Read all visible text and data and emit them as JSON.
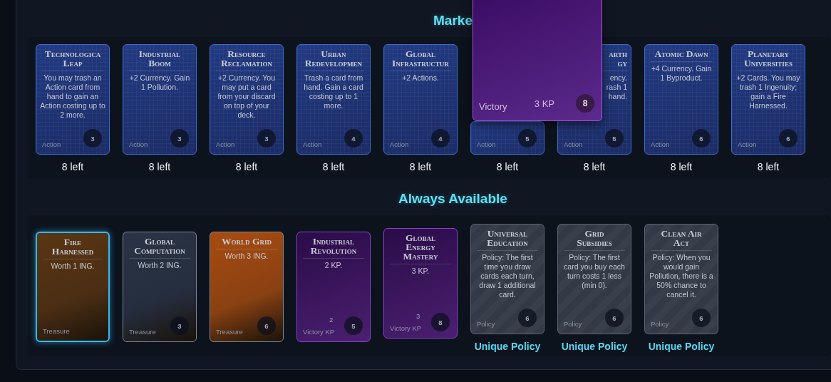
{
  "market": {
    "title": "Marke",
    "cards": [
      {
        "kind": "action",
        "title": "Technologica\nLeap",
        "text": "You may trash an Action card from hand to gain an Action costing up to 2 more.",
        "type": "Action",
        "cost": "3",
        "remaining": "8 left"
      },
      {
        "kind": "action",
        "title": "Industrial\nBoom",
        "text": "+2 Currency. Gain 1 Pollution.",
        "type": "Action",
        "cost": "3",
        "remaining": "8 left"
      },
      {
        "kind": "action",
        "title": "Resource\nReclamation",
        "text": "+2 Currency. You may put a card from your discard on top of your deck.",
        "type": "Action",
        "cost": "3",
        "remaining": "8 left"
      },
      {
        "kind": "action",
        "title": "Urban\nRedevelopmen",
        "text": "Trash a card from hand. Gain a card costing up to 1 more.",
        "type": "Action",
        "cost": "4",
        "remaining": "8 left"
      },
      {
        "kind": "action",
        "title": "Global\nInfrastructur",
        "text": "+2 Actions.",
        "type": "Action",
        "cost": "4",
        "remaining": "8 left"
      },
      {
        "kind": "clipped",
        "type": "Action",
        "cost": "5",
        "remaining": "8 left"
      },
      {
        "kind": "clipped",
        "title": "arth\ngy",
        "text": "ency.\nrash 1\nhand.",
        "type": "Action",
        "cost": "5",
        "remaining": "8 left"
      },
      {
        "kind": "action",
        "title": "Atomic Dawn",
        "text": "+4 Currency. Gain 1 Byproduct.",
        "type": "Action",
        "cost": "6",
        "remaining": "8 left"
      },
      {
        "kind": "action",
        "title": "Planetary\nUniversities",
        "text": "+2 Cards. You may trash 1 Ingenuity; gain a Fire Harnessed.",
        "type": "Action",
        "cost": "6",
        "remaining": "8 left"
      }
    ]
  },
  "preview": {
    "type": "Victory",
    "points": "3 KP",
    "cost": "8"
  },
  "always": {
    "title": "Always Available",
    "cards": [
      {
        "kind": "treasure",
        "color": "#5a3512",
        "selected": true,
        "title": "Fire\nHarnessed",
        "text": "Worth 1 ING.",
        "type": "Treasure"
      },
      {
        "kind": "treasure",
        "color": "#2b3446",
        "selected": false,
        "title": "Global\nComputation",
        "text": "Worth 2 ING.",
        "type": "Treasure",
        "cost": "3"
      },
      {
        "kind": "treasure",
        "color": "#a84c10",
        "selected": false,
        "title": "World Grid",
        "text": "Worth 3 ING.",
        "type": "Treasure",
        "cost": "6"
      },
      {
        "kind": "victory",
        "selected": false,
        "title": "Industrial\nRevolution",
        "text": "2 KP.",
        "points": "2",
        "type": "Victory KP",
        "cost": "5"
      },
      {
        "kind": "victory",
        "selected": false,
        "title": "Global\nEnergy\nMastery",
        "text": "3 KP.",
        "points": "3",
        "type": "Victory KP",
        "cost": "8"
      },
      {
        "kind": "policy",
        "selected": false,
        "title": "Universal\nEducation",
        "text": "Policy: The first time you draw cards each turn, draw 1 additional card.",
        "type": "Policy",
        "cost": "6",
        "label": "Unique Policy"
      },
      {
        "kind": "policy",
        "selected": false,
        "title": "Grid\nSubsidies",
        "text": "Policy: The first card you buy each turn costs 1 less (min 0).",
        "type": "Policy",
        "cost": "6",
        "label": "Unique Policy"
      },
      {
        "kind": "policy",
        "selected": false,
        "title": "Clean Air\nAct",
        "text": "Policy: When you would gain Pollution, there is a 50% chance to cancel it.",
        "type": "Policy",
        "cost": "6",
        "label": "Unique Policy"
      }
    ]
  }
}
